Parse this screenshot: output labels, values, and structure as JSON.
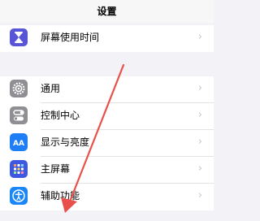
{
  "header": {
    "title": "设置"
  },
  "group1": {
    "items": [
      {
        "label": "屏幕使用时间",
        "icon": "hourglass-icon",
        "color": "#5856d6"
      }
    ]
  },
  "group2": {
    "items": [
      {
        "label": "通用",
        "icon": "gear-icon",
        "color": "#8e8e93"
      },
      {
        "label": "控制中心",
        "icon": "switches-icon",
        "color": "#8e8e93"
      },
      {
        "label": "显示与亮度",
        "icon": "aa-text-icon",
        "color": "#1f7ef6"
      },
      {
        "label": "主屏幕",
        "icon": "grid-icon",
        "color": "#3d59e0"
      },
      {
        "label": "辅助功能",
        "icon": "accessibility-icon",
        "color": "#1a86f8"
      }
    ]
  },
  "icons": {
    "aa_text": "AA"
  },
  "annotation": {
    "color": "#e8514a"
  }
}
